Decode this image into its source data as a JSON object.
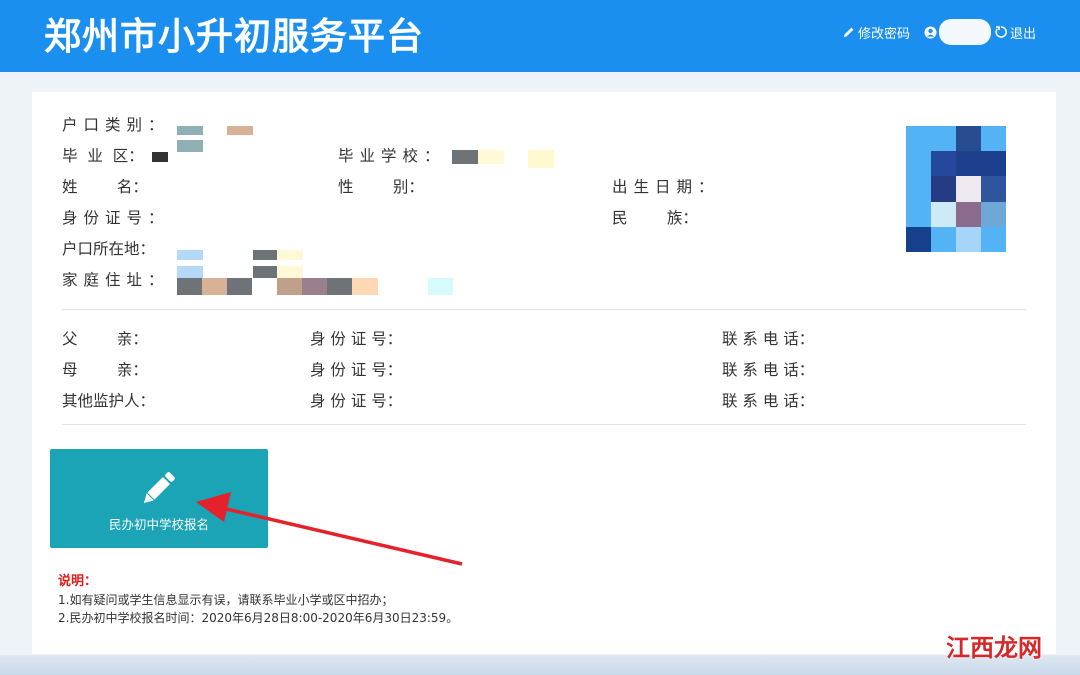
{
  "app": {
    "title": "郑州市小升初服务平台"
  },
  "header": {
    "change_password": "修改密码",
    "logout": "退出"
  },
  "student": {
    "hukou_type_label": "户口类别：",
    "district_label": "毕  业  区：",
    "school_label": "毕业学校：",
    "name_label": "姓        名：",
    "gender_label": "性        别：",
    "birth_label": "出生日期：",
    "idcard_label": "身份证号：",
    "ethnicity_label": "民        族：",
    "hukou_addr_label": "户口所在地：",
    "home_addr_label": "家庭住址："
  },
  "guardians": [
    {
      "role": "父        亲：",
      "id_label": "身 份 证 号：",
      "phone_label": "联 系 电 话："
    },
    {
      "role": "母        亲：",
      "id_label": "身 份 证 号：",
      "phone_label": "联 系 电 话："
    },
    {
      "role": "其他监护人：",
      "id_label": "身 份 证 号：",
      "phone_label": "联 系 电 话："
    }
  ],
  "actions": {
    "register_label": "民办初中学校报名"
  },
  "notes": {
    "title": "说明：",
    "items": [
      "1.如有疑问或学生信息显示有误，请联系毕业小学或区中招办；",
      "2.民办初中学校报名时间：2020年6月28日8:00-2020年6月30日23:59。"
    ]
  },
  "watermark": "江西龙网",
  "icons": {
    "pencil_edit": "pencil-icon",
    "user": "user-icon",
    "logout": "logout-icon",
    "register": "pencil-icon"
  },
  "colors": {
    "header": "#1a8ff0",
    "register_button": "#1ba3b6",
    "notes_title": "#e21b1b",
    "arrow": "#e3222b"
  }
}
